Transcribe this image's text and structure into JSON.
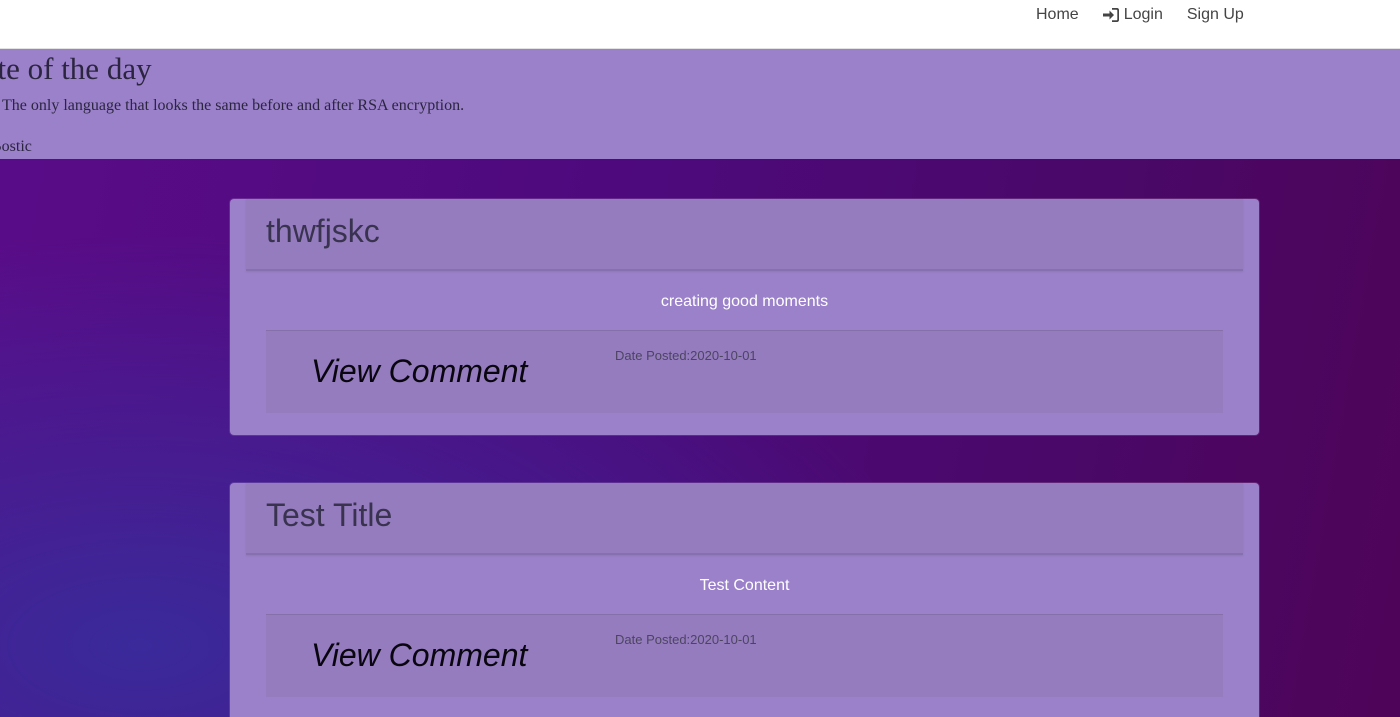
{
  "nav": {
    "items": [
      {
        "label": "Home",
        "icon": ""
      },
      {
        "label": "Login",
        "icon": "sign-in-icon"
      },
      {
        "label": "Sign Up",
        "icon": ""
      }
    ]
  },
  "quote": {
    "heading": "ote of the day",
    "text": "The only language that looks the same before and after RSA encryption.",
    "author": "Bostic"
  },
  "posts": [
    {
      "title": "thwfjskc",
      "content": "creating good moments",
      "view_comment_label": "View Comment",
      "date_posted": "Date Posted:2020-10-01"
    },
    {
      "title": "Test Title",
      "content": "Test Content",
      "view_comment_label": "View Comment",
      "date_posted": "Date Posted:2020-10-01"
    }
  ],
  "colors": {
    "banner": "#9b81ca",
    "card": "#9b81ca",
    "card_inner": "#947cbf",
    "background": "#4d0a7c"
  }
}
